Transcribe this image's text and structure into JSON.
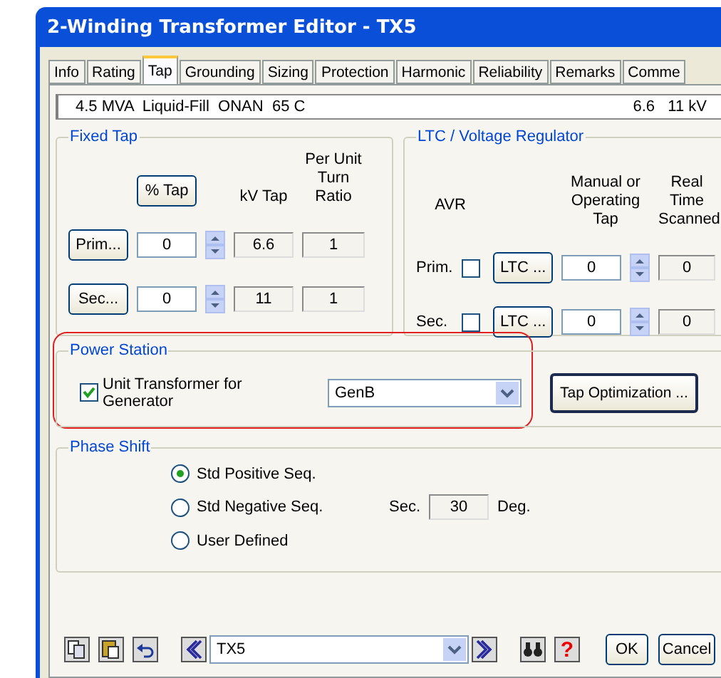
{
  "window": {
    "title": "2-Winding Transformer Editor - TX5"
  },
  "tabs": [
    {
      "label": "Info",
      "selected": false
    },
    {
      "label": "Rating",
      "selected": false
    },
    {
      "label": "Tap",
      "selected": true
    },
    {
      "label": "Grounding",
      "selected": false
    },
    {
      "label": "Sizing",
      "selected": false
    },
    {
      "label": "Protection",
      "selected": false
    },
    {
      "label": "Harmonic",
      "selected": false
    },
    {
      "label": "Reliability",
      "selected": false
    },
    {
      "label": "Remarks",
      "selected": false
    },
    {
      "label": "Comme",
      "selected": false
    }
  ],
  "info": {
    "rating": "4.5 MVA  Liquid-Fill  ONAN  65 C",
    "voltage": "6.6   11 kV"
  },
  "fixed_tap": {
    "title": "Fixed Tap",
    "pct_button": "% Tap",
    "kv_header": "kV Tap",
    "ratio_header": "Per Unit Turn Ratio",
    "rows": [
      {
        "button": "Prim...",
        "tap": "0",
        "kv": "6.6",
        "ratio": "1"
      },
      {
        "button": "Sec...",
        "tap": "0",
        "kv": "11",
        "ratio": "1"
      }
    ]
  },
  "ltc": {
    "title": "LTC / Voltage Regulator",
    "avr_header": "AVR",
    "manual_header": "Manual or Operating Tap",
    "scanned_header": "Real Time Scanned",
    "rows": [
      {
        "label": "Prim.",
        "checked": false,
        "button": "LTC ...",
        "tap": "0",
        "scanned": "0"
      },
      {
        "label": "Sec.",
        "checked": false,
        "button": "LTC ...",
        "tap": "0",
        "scanned": "0"
      }
    ]
  },
  "power_station": {
    "title": "Power Station",
    "checkbox_label": "Unit Transformer for Generator",
    "checked": true,
    "generator": "GenB",
    "button": "Tap Optimization ..."
  },
  "phase_shift": {
    "title": "Phase Shift",
    "options": [
      {
        "label": "Std Positive Seq.",
        "selected": true
      },
      {
        "label": "Std Negative Seq.",
        "selected": false
      },
      {
        "label": "User Defined",
        "selected": false
      }
    ],
    "sec_label": "Sec.",
    "angle": "30",
    "unit": "Deg."
  },
  "footer": {
    "element": "TX5",
    "help": "?",
    "ok": "OK",
    "cancel": "Cancel"
  }
}
